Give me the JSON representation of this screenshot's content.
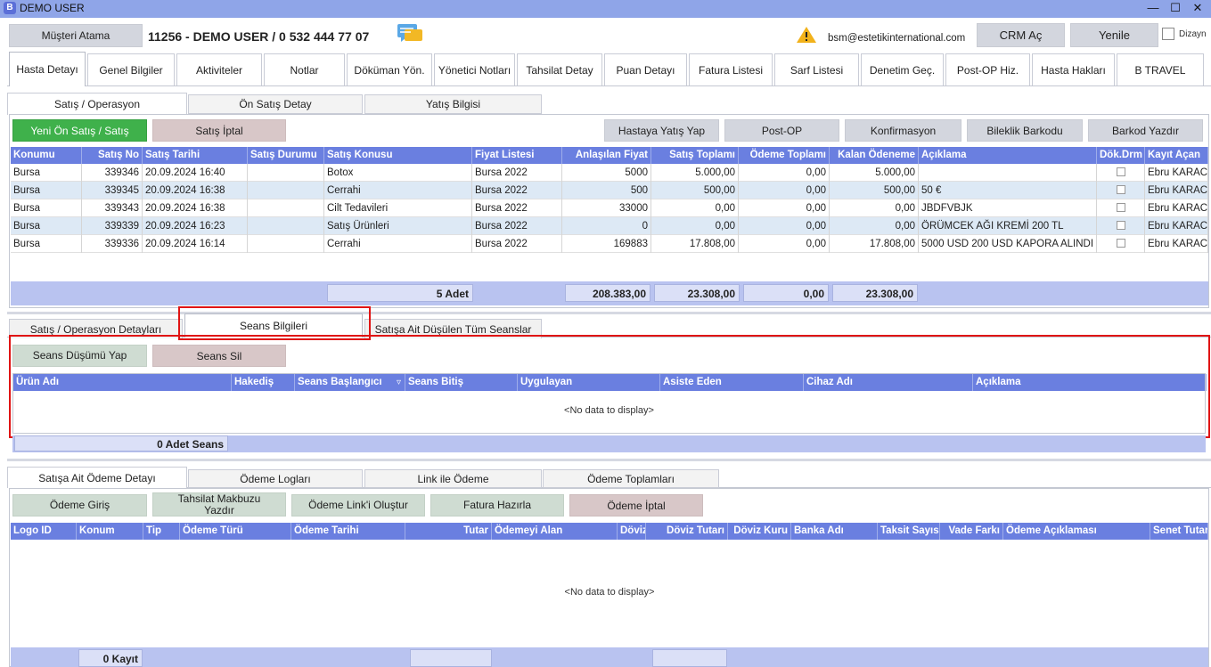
{
  "window": {
    "title": "DEMO USER",
    "logo_letter": "B",
    "min": "—",
    "max": "☐",
    "close": "✕"
  },
  "header": {
    "assign_btn": "Müşteri Atama",
    "info": "11256 - DEMO USER / 0 532 444 77 07",
    "email": "bsm@estetikinternational.com",
    "crm_btn": "CRM Aç",
    "refresh_btn": "Yenile",
    "design_label": "Dizayn"
  },
  "main_tabs": [
    "Hasta Detayı",
    "Genel Bilgiler",
    "Aktiviteler",
    "Notlar",
    "Döküman Yön.",
    "Yönetici Notları",
    "Tahsilat Detay",
    "Puan Detayı",
    "Fatura Listesi",
    "Sarf Listesi",
    "Denetim Geç.",
    "Post-OP Hiz.",
    "Hasta Hakları",
    "B TRAVEL"
  ],
  "sales_tabs": [
    "Satış / Operasyon",
    "Ön Satış Detay",
    "Yatış Bilgisi"
  ],
  "sales_buttons": {
    "new": "Yeni Ön Satış / Satış",
    "cancel": "Satış İptal",
    "admit": "Hastaya Yatış Yap",
    "postop": "Post-OP",
    "confirm": "Konfirmasyon",
    "bracelet": "Bileklik Barkodu",
    "barcode": "Barkod Yazdır"
  },
  "sales_columns": [
    "Konumu",
    "Satış No",
    "Satış Tarihi",
    "Satış Durumu",
    "Satış Konusu",
    "Fiyat Listesi",
    "Anlaşılan Fiyat",
    "Satış Toplamı",
    "Ödeme Toplamı",
    "Kalan Ödeneme",
    "Açıklama",
    "Dök.Drm",
    "Kayıt Açan"
  ],
  "sales_rows": [
    [
      "Bursa",
      "339346",
      "20.09.2024 16:40",
      "",
      "Botox",
      "Bursa 2022",
      "5000",
      "5.000,00",
      "0,00",
      "5.000,00",
      "",
      "",
      "Ebru KARACA"
    ],
    [
      "Bursa",
      "339345",
      "20.09.2024 16:38",
      "",
      "Cerrahi",
      "Bursa 2022",
      "500",
      "500,00",
      "0,00",
      "500,00",
      "50 €",
      "",
      "Ebru KARACA"
    ],
    [
      "Bursa",
      "339343",
      "20.09.2024 16:38",
      "",
      "Cilt Tedavileri",
      "Bursa 2022",
      "33000",
      "0,00",
      "0,00",
      "0,00",
      "JBDFVBJK",
      "",
      "Ebru KARACA"
    ],
    [
      "Bursa",
      "339339",
      "20.09.2024 16:23",
      "",
      "Satış Ürünleri",
      "Bursa 2022",
      "0",
      "0,00",
      "0,00",
      "0,00",
      "ÖRÜMCEK AĞI KREMİ 200 TL",
      "",
      "Ebru KARACA"
    ],
    [
      "Bursa",
      "339336",
      "20.09.2024 16:14",
      "",
      "Cerrahi",
      "Bursa 2022",
      "169883",
      "17.808,00",
      "0,00",
      "17.808,00",
      "5000 USD 200 USD KAPORA ALINDI",
      "",
      "Ebru KARACA"
    ]
  ],
  "sales_footer": {
    "count": "5 Adet",
    "agreed": "208.383,00",
    "total": "23.308,00",
    "paid": "0,00",
    "remaining": "23.308,00"
  },
  "session_tabs": [
    "Satış / Operasyon Detayları",
    "Seans Bilgileri",
    "Satışa Ait Düşülen Tüm Seanslar"
  ],
  "session_buttons": {
    "deduct": "Seans Düşümü Yap",
    "delete": "Seans Sil"
  },
  "session_columns": [
    "Ürün Adı",
    "Hakediş",
    "Seans Başlangıcı",
    "Seans Bitiş",
    "Uygulayan",
    "Asiste Eden",
    "Cihaz Adı",
    "Açıklama"
  ],
  "session_nodata": "<No data to display>",
  "session_footer": "0 Adet Seans",
  "payment_tabs": [
    "Satışa Ait Ödeme Detayı",
    "Ödeme Logları",
    "Link ile Ödeme",
    "Ödeme Toplamları"
  ],
  "payment_buttons": {
    "entry": "Ödeme Giriş",
    "receipt": "Tahsilat Makbuzu Yazdır",
    "link": "Ödeme Link'i Oluştur",
    "invoice": "Fatura Hazırla",
    "cancel": "Ödeme İptal"
  },
  "payment_columns": [
    "Logo ID",
    "Konum",
    "Tip",
    "Ödeme Türü",
    "Ödeme Tarihi",
    "Tutar",
    "Ödemeyi Alan",
    "Döviz",
    "Döviz Tutarı",
    "Döviz Kuru",
    "Banka Adı",
    "Taksit Sayısı",
    "Vade Farkı",
    "Ödeme Açıklaması",
    "Senet Tutarı"
  ],
  "payment_nodata": "<No data to display>",
  "payment_footer": "0 Kayıt",
  "colors": {
    "title_bar": "#8fa5e8",
    "grid_header": "#6a7fe0",
    "green": "#3fb14b",
    "highlight_red": "#e01414"
  }
}
